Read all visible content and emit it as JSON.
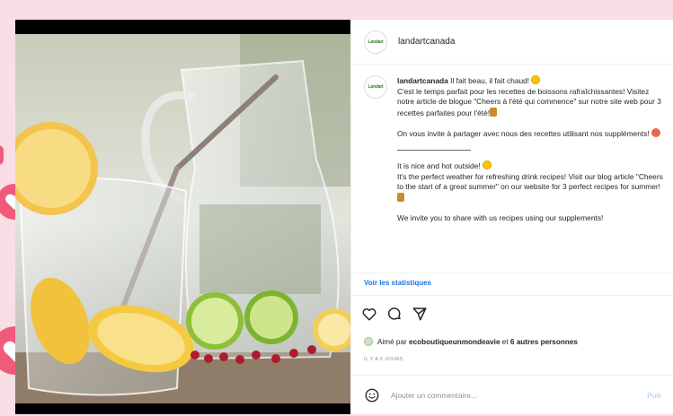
{
  "post": {
    "username": "landartcanada",
    "avatar_text": "Landart",
    "caption": {
      "intro": " Il fait beau, il fait chaud! ",
      "fr_1": "C'est le temps parfait pour les recettes de boissons rafraîchissantes! Visitez notre article de blogue \"Cheers à l'été qui commence\" sur notre site web pour 3 recettes parfaites pour l'été!",
      "fr_2": "On vous invite à partager avec nous des recettes utilisant nos suppléments! ",
      "en_1": "It is nice and hot outside! ",
      "en_2": "It's the perfect weather for refreshing drink recipes! Visit our blog article \"Cheers to the start of a great summer\" on our website for 3 perfect recipes for summer!",
      "en_3": "We invite you to share with us recipes using our supplements!"
    },
    "stats_link": "Voir les statistiques",
    "likes": {
      "prefix": "Aimé par ",
      "user": "ecoboutiqueunmondeavie",
      "middle": " et ",
      "others": "6 autres personnes"
    },
    "date": "IL Y A 6 JOURS",
    "comment": {
      "placeholder": "Ajouter un commentaire...",
      "publish": "Pub"
    }
  },
  "icons": {
    "like": "heart-outline-icon",
    "comment": "comment-bubble-icon",
    "share": "paper-plane-icon",
    "emoji": "smiley-icon"
  },
  "colors": {
    "background": "#f9dfe5",
    "accent_pink": "#f05b7a",
    "link_blue": "#1b74e4",
    "publish_blue": "#b3dbff"
  }
}
